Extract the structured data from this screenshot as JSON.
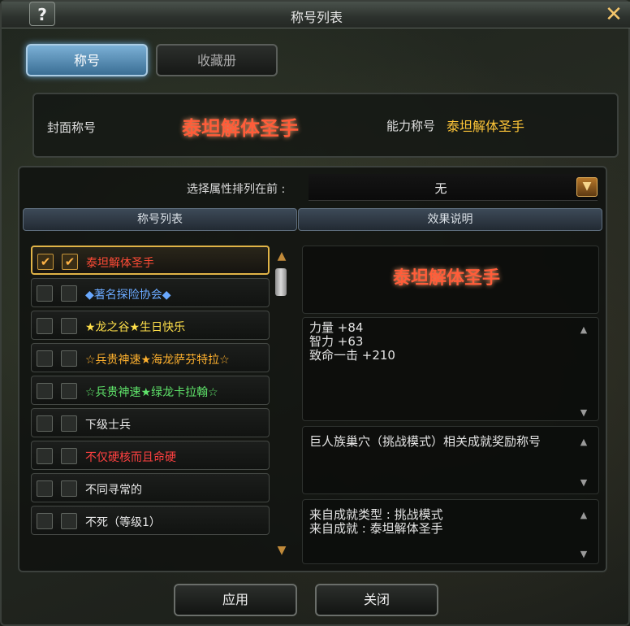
{
  "window": {
    "title": "称号列表",
    "help_label": "?",
    "close_label": "✕"
  },
  "tabs": [
    {
      "label": "称号",
      "active": true
    },
    {
      "label": "收藏册",
      "active": false
    }
  ],
  "cover": {
    "cover_label": "封面称号",
    "cover_title": "泰坦解体圣手",
    "ability_label": "能力称号",
    "ability_title": "泰坦解体圣手"
  },
  "sort": {
    "label": "选择属性排列在前 :",
    "value": "无"
  },
  "headers": {
    "list": "称号列表",
    "effect": "效果说明"
  },
  "titles": [
    {
      "text": "泰坦解体圣手",
      "color": "#ff4b36",
      "cb1": true,
      "cb2": true,
      "selected": true
    },
    {
      "text": "◆著名探险协会◆",
      "color": "#6aa9ff",
      "cb1": false,
      "cb2": false,
      "selected": false
    },
    {
      "text": "★龙之谷★生日快乐",
      "color": "#ffe04a",
      "cb1": false,
      "cb2": false,
      "selected": false
    },
    {
      "text": "☆兵贵神速★海龙萨芬特拉☆",
      "color": "#ffb12e",
      "cb1": false,
      "cb2": false,
      "selected": false
    },
    {
      "text": "☆兵贵神速★绿龙卡拉翰☆",
      "color": "#5fe46a",
      "cb1": false,
      "cb2": false,
      "selected": false
    },
    {
      "text": "下级士兵",
      "color": "#e8e8e8",
      "cb1": false,
      "cb2": false,
      "selected": false
    },
    {
      "text": "不仅硬核而且命硬",
      "color": "#ff4040",
      "cb1": false,
      "cb2": false,
      "selected": false
    },
    {
      "text": "不同寻常的",
      "color": "#e8e8e8",
      "cb1": false,
      "cb2": false,
      "selected": false
    },
    {
      "text": "不死（等级1）",
      "color": "#e8e8e8",
      "cb1": false,
      "cb2": false,
      "selected": false
    }
  ],
  "detail": {
    "title": "泰坦解体圣手",
    "stats": [
      "力量 +84",
      "智力 +63",
      "致命一击 +210"
    ],
    "description": "巨人族巢穴（挑战模式）相关成就奖励称号",
    "source": [
      "来自成就类型 : 挑战模式",
      "来自成就 : 泰坦解体圣手"
    ]
  },
  "buttons": {
    "apply": "应用",
    "close": "关闭"
  },
  "icons": {
    "scroll_up": "▲",
    "scroll_down": "▼",
    "dropdown": "chevron-down-icon"
  }
}
